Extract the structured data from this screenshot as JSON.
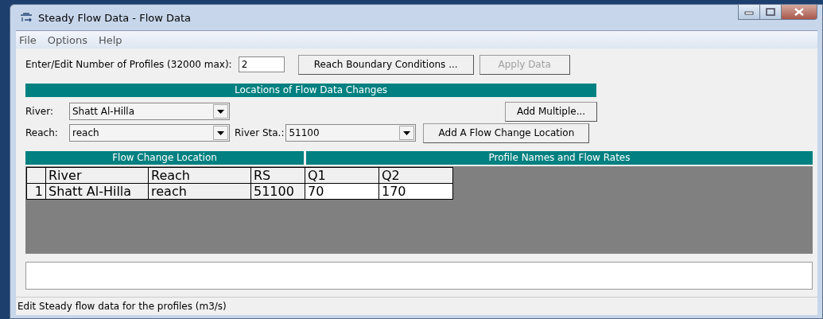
{
  "window": {
    "title": "Steady Flow Data - Flow Data"
  },
  "menu": [
    "File",
    "Options",
    "Help"
  ],
  "profiles": {
    "label": "Enter/Edit Number of Profiles (32000 max):",
    "value": "2"
  },
  "top_buttons": [
    {
      "label": "Reach Boundary Conditions ...",
      "disabled": false
    },
    {
      "label": "Apply Data",
      "disabled": true
    }
  ],
  "locations": {
    "title": "Locations of Flow Data Changes",
    "river": {
      "label": "River:",
      "value": "Shatt Al-Hilla"
    },
    "reach": {
      "label": "Reach:",
      "value": "reach"
    },
    "river_sta": {
      "label": "River Sta.:",
      "value": "51100"
    },
    "add_multiple": "Add Multiple...",
    "add_location": "Add A Flow Change Location"
  },
  "table": {
    "group_headers": [
      "Flow Change Location",
      "Profile Names and Flow Rates"
    ],
    "columns": [
      "River",
      "Reach",
      "RS",
      "Q1",
      "Q2"
    ],
    "rows": [
      {
        "number": "1",
        "cells": [
          "Shatt Al-Hilla",
          "reach",
          "51100",
          "70",
          "170"
        ]
      }
    ]
  },
  "status_bar": "Edit Steady flow data for the profiles (m3/s)"
}
